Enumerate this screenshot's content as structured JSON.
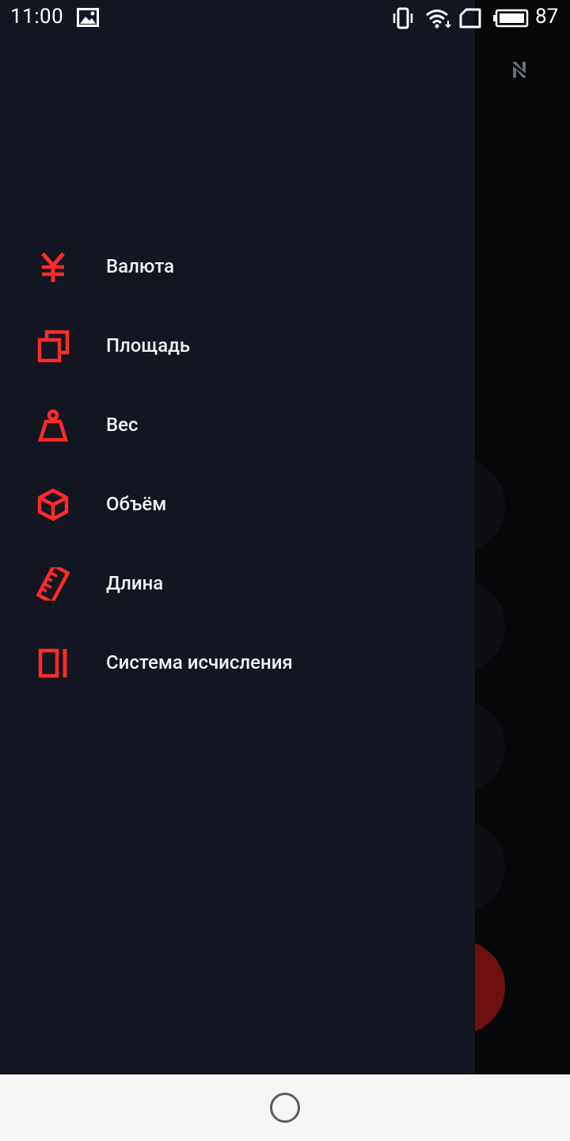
{
  "status_bar": {
    "time": "11:00",
    "battery_level": "87",
    "icons": [
      "image-icon",
      "vibrate-icon",
      "wifi-icon",
      "sim-icon",
      "battery-icon"
    ]
  },
  "background_app": {
    "icons": [
      "orientation-lock-icon"
    ]
  },
  "drawer": {
    "items": [
      {
        "label": "Валюта",
        "icon": "yen-currency-icon"
      },
      {
        "label": "Площадь",
        "icon": "area-squares-icon"
      },
      {
        "label": "Вес",
        "icon": "weight-icon"
      },
      {
        "label": "Объём",
        "icon": "volume-cube-icon"
      },
      {
        "label": "Длина",
        "icon": "ruler-icon"
      },
      {
        "label": "Система исчисления",
        "icon": "number-system-icon"
      }
    ]
  },
  "nav_bar": {
    "icons": [
      "home-circle-icon"
    ]
  },
  "colors": {
    "accent": "#ff2a2a",
    "drawer_bg": "#111620",
    "text": "#f3f3f3"
  }
}
